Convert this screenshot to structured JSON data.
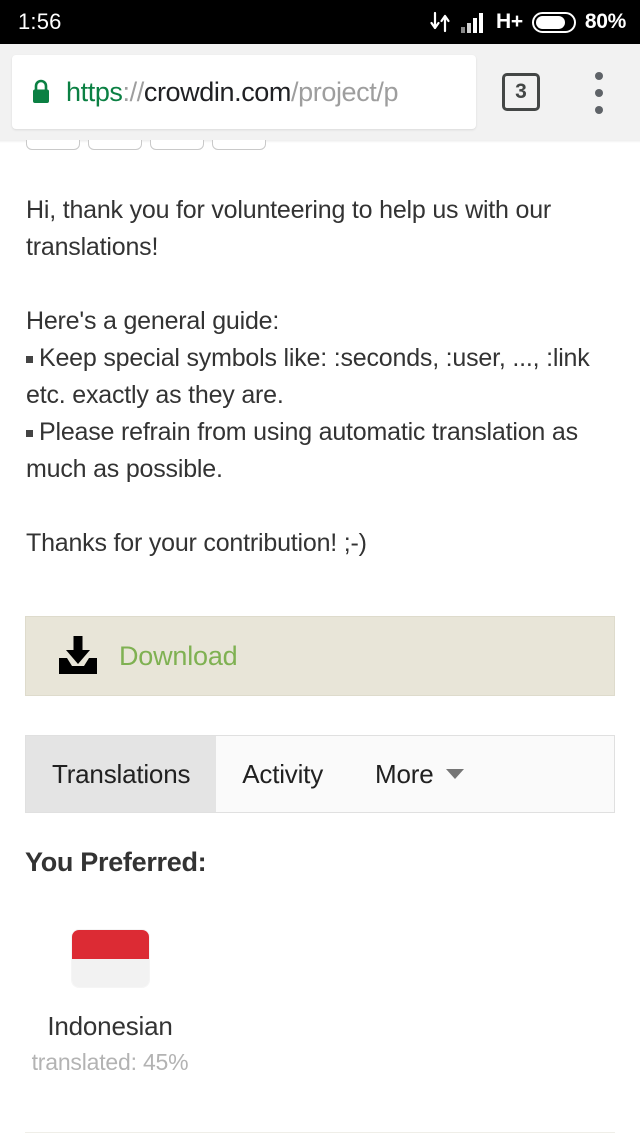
{
  "status_bar": {
    "clock": "1:56",
    "network_type": "H+",
    "battery_percent": "80%",
    "battery_level": 80,
    "icons": [
      "data-transfer-icon",
      "signal-bars-icon",
      "battery-icon"
    ]
  },
  "browser": {
    "url": {
      "scheme": "https",
      "separator": "://",
      "host": "crowdin.com",
      "path": "/project/p",
      "full": "https://crowdin.com/project/p"
    },
    "secure_icon": "lock-icon",
    "tab_count": "3",
    "menu_icon": "three-dot-menu-icon"
  },
  "content": {
    "paragraphs": [
      "Hi, thank you for volunteering to help us with our translations!",
      "Here's a general guide:",
      "Keep special symbols like: :seconds, :user, ..., :link etc. exactly as they are.",
      "Please refrain from using automatic translation as much as possible.",
      "Thanks for your contribution! ;-)"
    ],
    "download": {
      "label": "Download",
      "icon": "download-icon",
      "background_color": "#e8e5d8",
      "text_color": "#7fb152"
    },
    "tabs": [
      {
        "label": "Translations",
        "active": true,
        "has_caret": false
      },
      {
        "label": "Activity",
        "active": false,
        "has_caret": false
      },
      {
        "label": "More",
        "active": false,
        "has_caret": true
      }
    ],
    "preferred": {
      "heading": "You Preferred:",
      "languages": [
        {
          "name": "Indonesian",
          "progress": "translated: 45%",
          "flag": {
            "top_color": "#dc2b34",
            "bottom_color": "#f2f2f2"
          }
        }
      ]
    }
  }
}
